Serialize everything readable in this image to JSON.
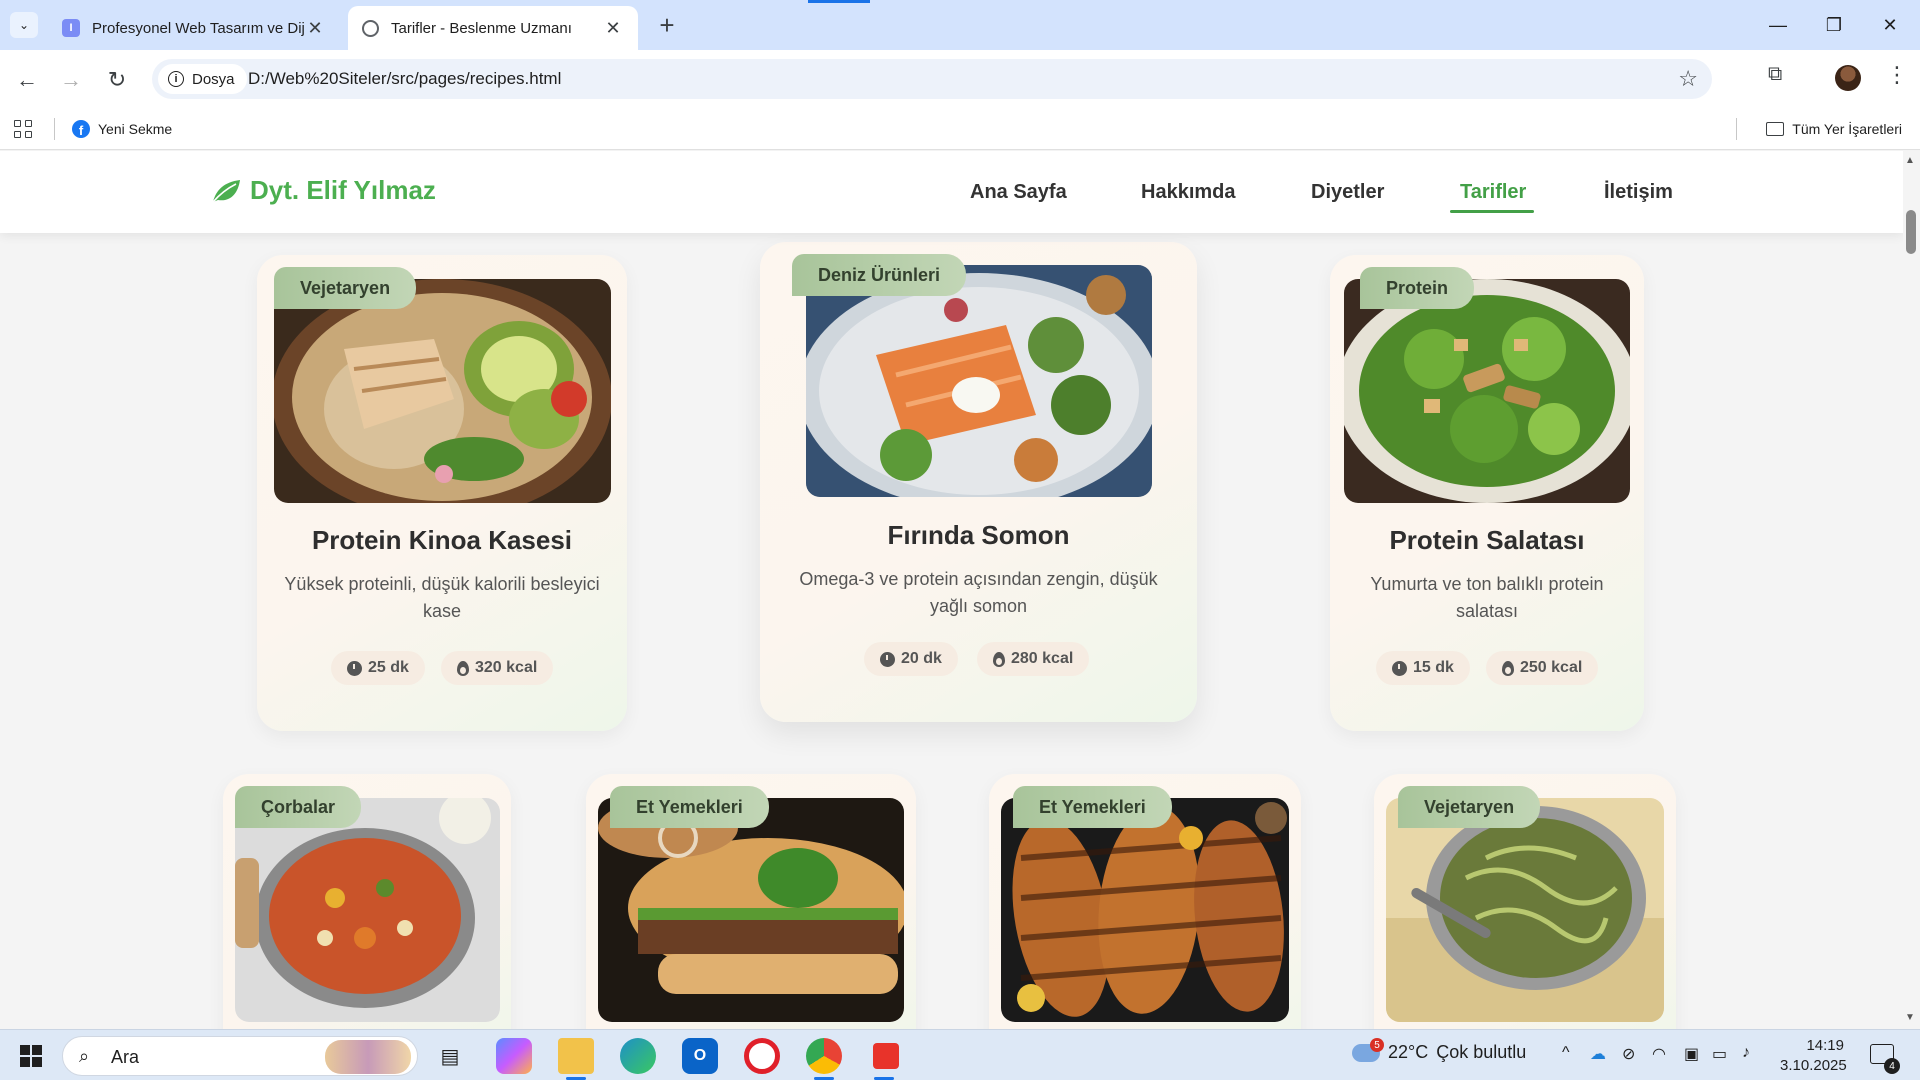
{
  "browser": {
    "tabs": [
      {
        "title": "Profesyonel Web Tasarım ve Dijital",
        "active": false
      },
      {
        "title": "Tarifler - Beslenme Uzmanı",
        "active": true
      }
    ],
    "newtab": "+",
    "window_controls": {
      "minimize": "—",
      "maximize": "❐",
      "close": "✕"
    },
    "chip_label": "Dosya",
    "url": "D:/Web%20Siteler/src/pages/recipes.html",
    "bookmarks": [
      {
        "label": "Yeni Sekme"
      }
    ],
    "all_bookmarks": "Tüm Yer İşaretleri"
  },
  "site": {
    "logo": "Dyt. Elif Yılmaz",
    "nav": [
      {
        "label": "Ana Sayfa",
        "active": false
      },
      {
        "label": "Hakkımda",
        "active": false
      },
      {
        "label": "Diyetler",
        "active": false
      },
      {
        "label": "Tarifler",
        "active": true
      },
      {
        "label": "İletişim",
        "active": false
      }
    ],
    "accent": "#43a047"
  },
  "recipes_row1": [
    {
      "category": "Vejetaryen",
      "title": "Protein Kinoa Kasesi",
      "desc": "Yüksek proteinli, düşük kalorili besleyici kase",
      "time": "25 dk",
      "kcal": "320 kcal"
    },
    {
      "category": "Deniz Ürünleri",
      "title": "Fırında Somon",
      "desc": "Omega-3 ve protein açısından zengin, düşük yağlı somon",
      "time": "20 dk",
      "kcal": "280 kcal"
    },
    {
      "category": "Protein",
      "title": "Protein Salatası",
      "desc": "Yumurta ve ton balıklı protein salatası",
      "time": "15 dk",
      "kcal": "250 kcal"
    }
  ],
  "recipes_row2": [
    {
      "category": "Çorbalar"
    },
    {
      "category": "Et Yemekleri"
    },
    {
      "category": "Et Yemekleri"
    },
    {
      "category": "Vejetaryen"
    }
  ],
  "taskbar": {
    "search_placeholder": "Ara",
    "weather_temp": "22°C",
    "weather_desc": "Çok bulutlu",
    "weather_badge": "5",
    "time": "14:19",
    "date": "3.10.2025",
    "notification_count": "4"
  }
}
